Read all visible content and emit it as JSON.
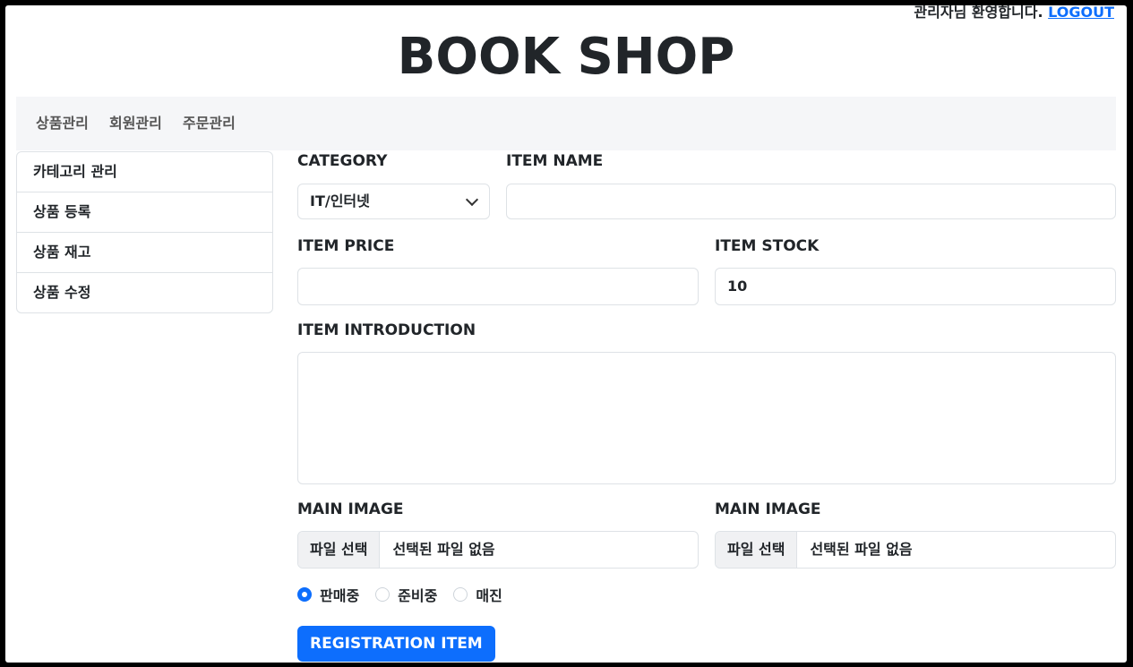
{
  "header": {
    "welcome_text": "관리자님 환영합니다.",
    "logout_label": "LOGOUT",
    "site_title": "BOOK SHOP"
  },
  "topnav": {
    "items": [
      {
        "label": "상품관리"
      },
      {
        "label": "회원관리"
      },
      {
        "label": "주문관리"
      }
    ]
  },
  "sidebar": {
    "items": [
      {
        "label": "카테고리 관리"
      },
      {
        "label": "상품 등록"
      },
      {
        "label": "상품 재고"
      },
      {
        "label": "상품 수정"
      }
    ]
  },
  "form": {
    "category_label": "CATEGORY",
    "category_value": "IT/인터넷",
    "item_name_label": "ITEM NAME",
    "item_name_value": "",
    "item_price_label": "ITEM PRICE",
    "item_price_value": "",
    "item_stock_label": "ITEM STOCK",
    "item_stock_value": "10",
    "intro_label": "ITEM INTRODUCTION",
    "intro_value": "",
    "main_image_1": {
      "label": "MAIN IMAGE",
      "button": "파일 선택",
      "status": "선택된 파일 없음"
    },
    "main_image_2": {
      "label": "MAIN IMAGE",
      "button": "파일 선택",
      "status": "선택된 파일 없음"
    },
    "status_options": [
      {
        "label": "판매중",
        "checked": true
      },
      {
        "label": "준비중",
        "checked": false
      },
      {
        "label": "매진",
        "checked": false
      }
    ],
    "submit_label": "REGISTRATION ITEM"
  },
  "colors": {
    "accent": "#0d6efd",
    "nav_bg": "#f5f6f8",
    "border": "#dee2e6"
  }
}
